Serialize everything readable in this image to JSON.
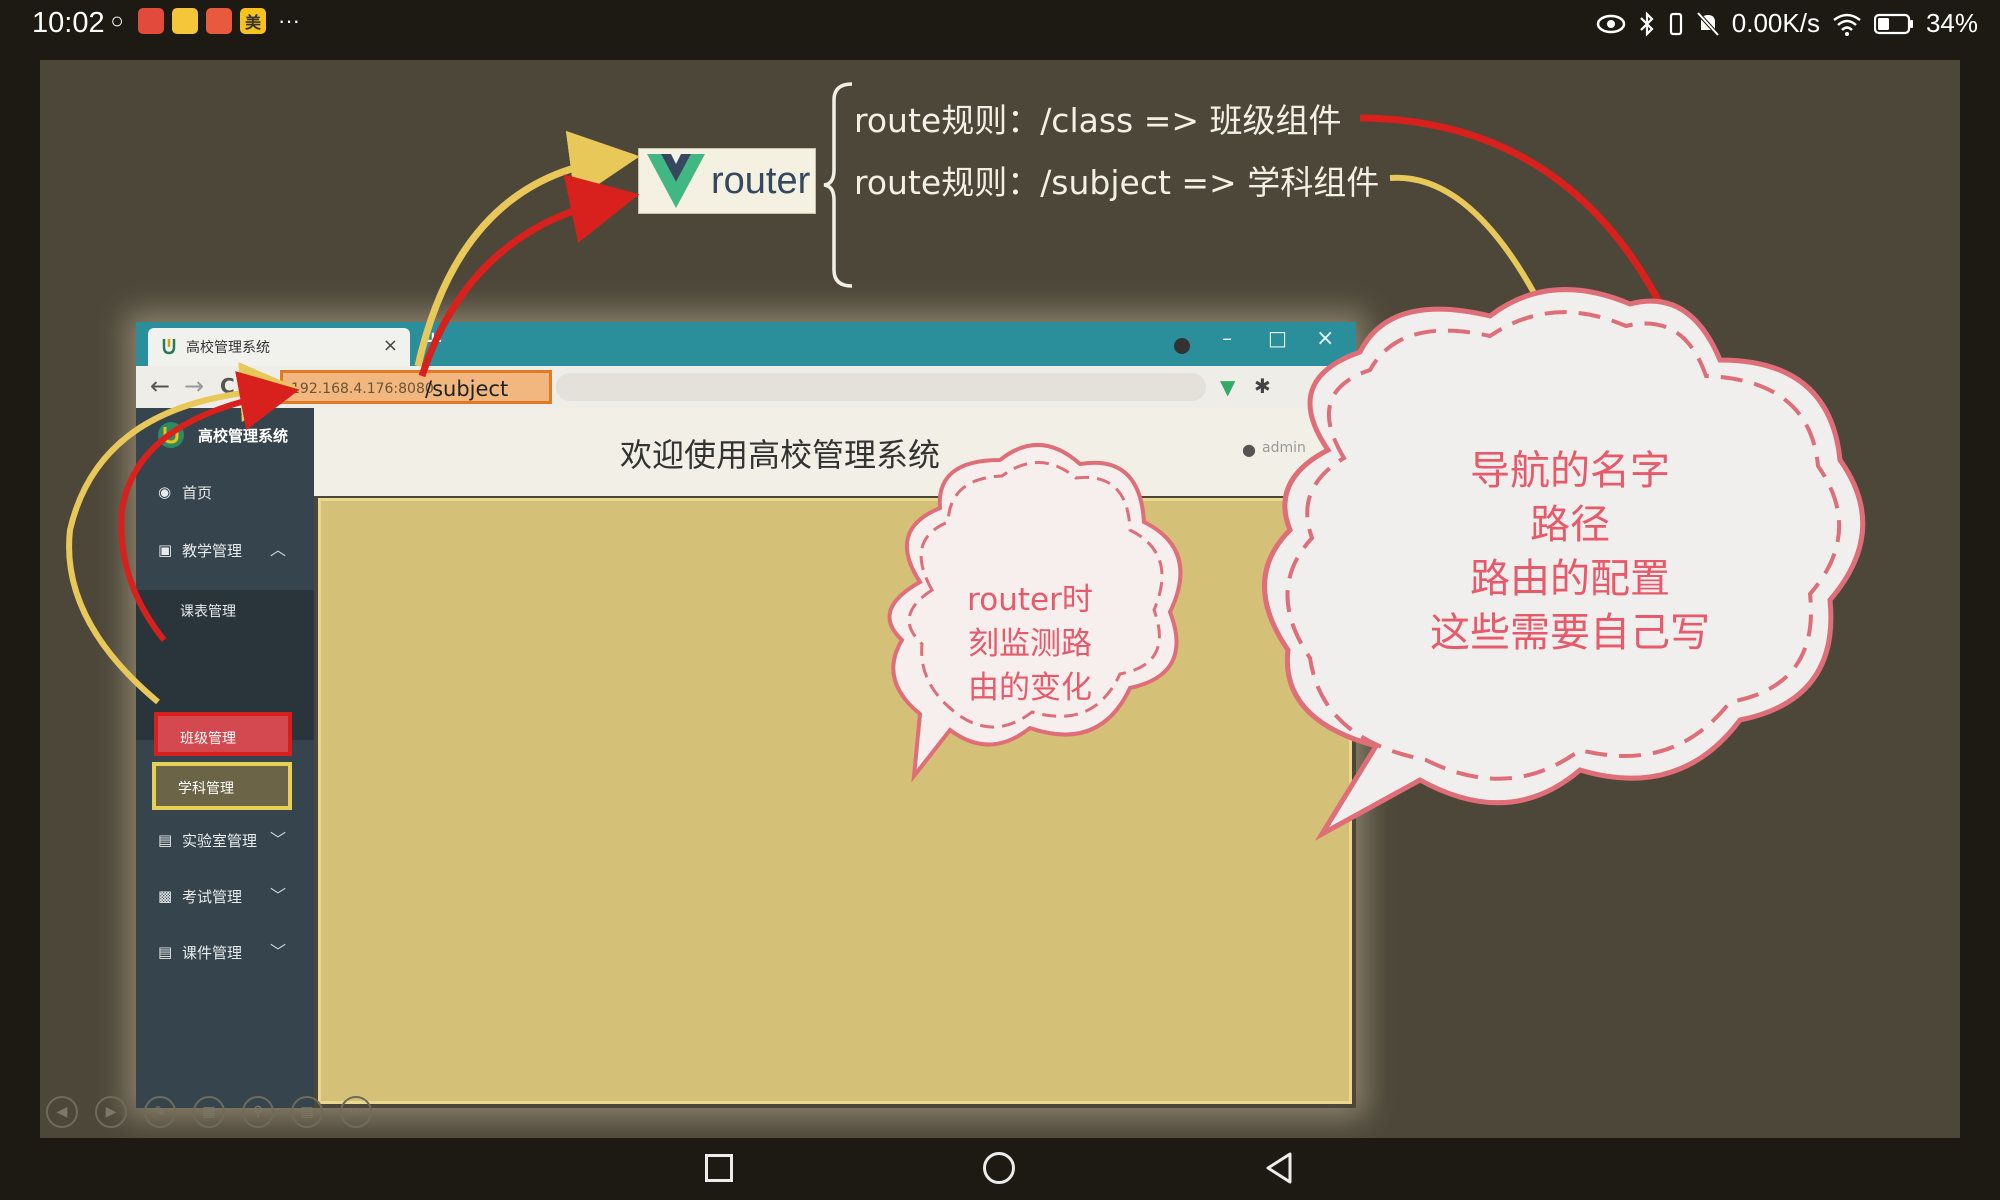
{
  "status_bar": {
    "time": "10:02",
    "app_icons": [
      "wechat-icon",
      "app-icon-1",
      "app-icon-2",
      "app-icon-3",
      "app-icon-美"
    ],
    "app_icon_meituan_label": "美",
    "more": "···",
    "network_speed": "0.00K/s",
    "battery": "34%"
  },
  "slide": {
    "logo_text": "router",
    "rules": [
      "route规则：/class =>  班级组件",
      "route规则：/subject => 学科组件"
    ],
    "colors": {
      "red_arrow": "#d8201c",
      "yellow_arrow": "#e9c85a",
      "cloud_text": "#e85a6a",
      "cloud_border": "#e06e78"
    }
  },
  "browser": {
    "tab_title": "高校管理系统",
    "tab_close": "×",
    "new_tab": "+",
    "window_buttons": {
      "minimize": "–",
      "maximize": "□",
      "close": "×"
    },
    "nav": {
      "back": "←",
      "forward": "→",
      "reload": "C"
    },
    "url_host": "192.168.4.176:8080",
    "url_path": "/subject"
  },
  "app": {
    "brand": "高校管理系统",
    "welcome": "欢迎使用高校管理系统",
    "user": "admin",
    "menu": [
      {
        "label": "首页",
        "icon": "dashboard-icon",
        "caret": ""
      },
      {
        "label": "教学管理",
        "icon": "monitor-icon",
        "caret": "︿"
      },
      {
        "label": "实验室管理",
        "icon": "doc-icon",
        "caret": "﹀"
      },
      {
        "label": "考试管理",
        "icon": "clipboard-icon",
        "caret": "﹀"
      },
      {
        "label": "课件管理",
        "icon": "doc-icon",
        "caret": "﹀"
      }
    ],
    "submenu": [
      "课表管理",
      "班级管理",
      "学科管理"
    ]
  },
  "callouts": {
    "small": [
      "router时",
      "刻监测路",
      "由的变化"
    ],
    "large": [
      "导航的名字",
      "路径",
      "路由的配置",
      "这些需要自己写"
    ]
  }
}
